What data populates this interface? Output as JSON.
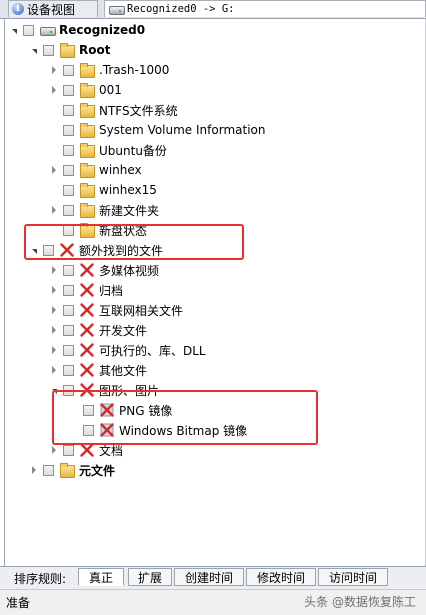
{
  "tabs": [
    {
      "label": "设备视图",
      "icon": "info-icon"
    },
    {
      "label": "Recognized0 -> G:",
      "icon": "drive-icon"
    }
  ],
  "tree": [
    {
      "label": "Recognized0",
      "icon": "drive-icon",
      "level": 0,
      "expander": "open",
      "bold": true
    },
    {
      "label": "Root",
      "icon": "folder-icon",
      "level": 1,
      "expander": "open",
      "bold": true
    },
    {
      "label": ".Trash-1000",
      "icon": "folder-icon",
      "level": 2,
      "expander": "closed"
    },
    {
      "label": "001",
      "icon": "folder-icon",
      "level": 2,
      "expander": "closed"
    },
    {
      "label": "NTFS文件系统",
      "icon": "folder-icon",
      "level": 2,
      "expander": "none"
    },
    {
      "label": "System Volume Information",
      "icon": "folder-icon",
      "level": 2,
      "expander": "none"
    },
    {
      "label": "Ubuntu备份",
      "icon": "folder-icon",
      "level": 2,
      "expander": "none"
    },
    {
      "label": "winhex",
      "icon": "folder-icon",
      "level": 2,
      "expander": "closed"
    },
    {
      "label": "winhex15",
      "icon": "folder-icon",
      "level": 2,
      "expander": "none"
    },
    {
      "label": "新建文件夹",
      "icon": "folder-icon",
      "level": 2,
      "expander": "closed"
    },
    {
      "label": "新盘状态",
      "icon": "folder-icon",
      "level": 2,
      "expander": "none"
    },
    {
      "label": "额外找到的文件",
      "icon": "red-x-icon",
      "level": 1,
      "expander": "open"
    },
    {
      "label": "多媒体视频",
      "icon": "red-x-icon",
      "level": 2,
      "expander": "closed"
    },
    {
      "label": "归档",
      "icon": "red-x-icon",
      "level": 2,
      "expander": "closed"
    },
    {
      "label": "互联网相关文件",
      "icon": "red-x-icon",
      "level": 2,
      "expander": "closed"
    },
    {
      "label": "开发文件",
      "icon": "red-x-icon",
      "level": 2,
      "expander": "closed"
    },
    {
      "label": "可执行的、库、DLL",
      "icon": "red-x-icon",
      "level": 2,
      "expander": "closed"
    },
    {
      "label": "其他文件",
      "icon": "red-x-icon",
      "level": 2,
      "expander": "closed"
    },
    {
      "label": "图形、图片",
      "icon": "red-x-icon",
      "level": 2,
      "expander": "open"
    },
    {
      "label": "PNG 镜像",
      "icon": "red-x-grey-icon",
      "level": 3,
      "expander": "none"
    },
    {
      "label": "Windows Bitmap 镜像",
      "icon": "red-x-grey-icon",
      "level": 3,
      "expander": "none"
    },
    {
      "label": "文档",
      "icon": "red-x-icon",
      "level": 2,
      "expander": "closed"
    },
    {
      "label": "元文件",
      "icon": "folder-icon",
      "level": 1,
      "expander": "closed",
      "bold": true
    }
  ],
  "sort": {
    "label": "排序规则:",
    "options": [
      "真正",
      "扩展",
      "创建时间",
      "修改时间",
      "访问时间"
    ],
    "active": "真正"
  },
  "status": {
    "text": "准备",
    "watermark": "头条 @数据恢复陈工"
  },
  "colors": {
    "highlight": "#e53131",
    "red_x": "#d42a2a"
  }
}
